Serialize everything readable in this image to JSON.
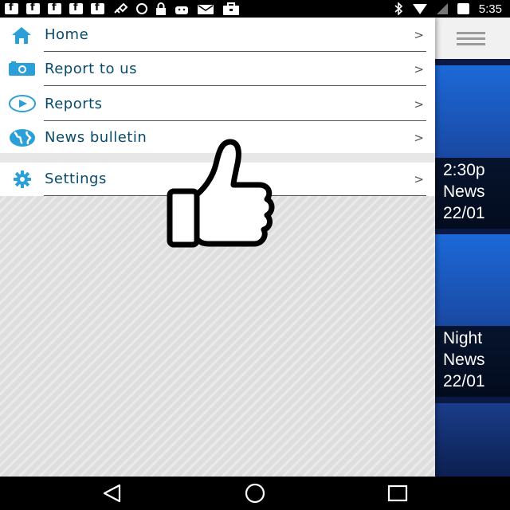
{
  "status_bar": {
    "time": "5:35",
    "left_icons": [
      "facebook-icon",
      "facebook-icon",
      "facebook-icon",
      "facebook-icon",
      "facebook-icon",
      "satellite-icon",
      "do-not-disturb-icon",
      "lock-icon",
      "android-icon",
      "mail-icon",
      "briefcase-icon"
    ],
    "right_icons": [
      "bluetooth-icon",
      "wifi-icon",
      "signal-icon",
      "battery-icon"
    ]
  },
  "drawer": {
    "items": [
      {
        "label": "Home",
        "icon": "home-icon",
        "chevron": ">"
      },
      {
        "label": "Report to us",
        "icon": "camera-icon",
        "chevron": ">"
      },
      {
        "label": "Reports",
        "icon": "play-icon",
        "chevron": ">"
      },
      {
        "label": "News bulletin",
        "icon": "globe-icon",
        "chevron": ">"
      },
      {
        "label": "Settings",
        "icon": "gear-icon",
        "chevron": ">"
      }
    ]
  },
  "background_app": {
    "menu_icon": "hamburger-menu-icon",
    "cards": [
      {
        "line1": "2:30p",
        "line2": "News",
        "line3": "22/01"
      },
      {
        "line1": "Night",
        "line2": "News",
        "line3": "22/01"
      }
    ]
  },
  "overlay": {
    "icon": "thumbs-up-icon"
  },
  "nav_bar": {
    "buttons": [
      "back-icon",
      "home-circle-icon",
      "recents-icon"
    ]
  },
  "colors": {
    "accent_blue": "#2a9fd8",
    "label_text": "#0a4b6c",
    "drawer_bg": "#dedede"
  }
}
